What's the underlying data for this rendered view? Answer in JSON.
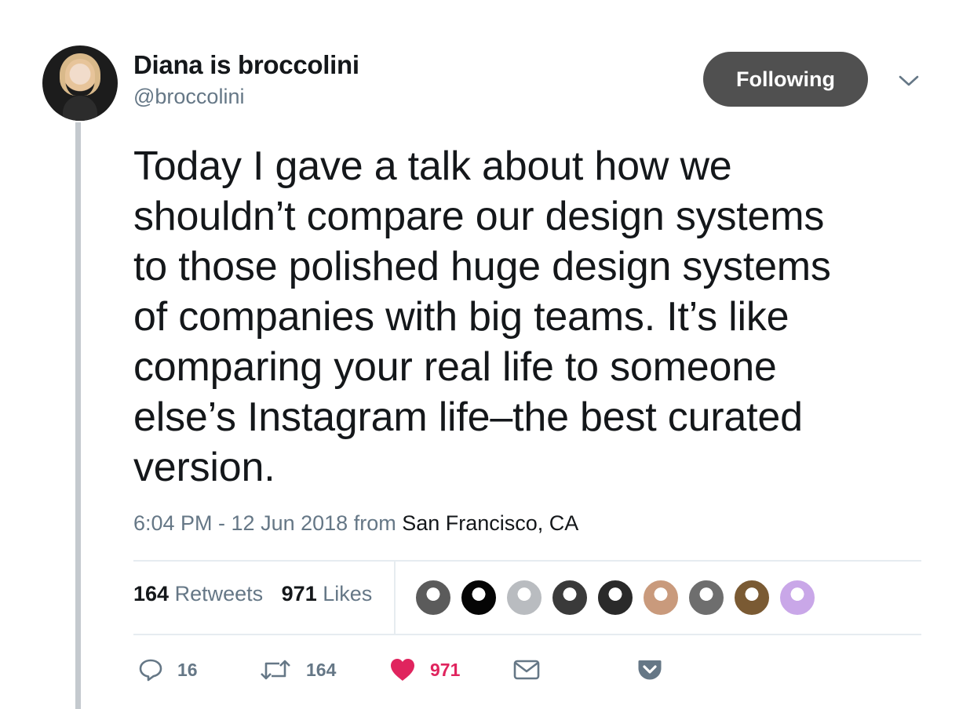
{
  "author": {
    "display_name": "Diana is broccolini",
    "handle": "@broccolini"
  },
  "follow_button": {
    "label": "Following"
  },
  "tweet": {
    "text_lines": [
      "Today I gave a talk about how we",
      "shouldn’t compare our design systems",
      "to those polished huge design systems",
      "of companies with big teams. It’s like",
      "comparing your real life to someone",
      "else’s Instagram life–the best curated",
      "version."
    ],
    "timestamp": "6:04 PM - 12 Jun 2018",
    "from_label": "from",
    "location": "San Francisco, CA"
  },
  "stats": {
    "retweets_count": "164",
    "retweets_label": "Retweets",
    "likes_count": "971",
    "likes_label": "Likes"
  },
  "likers": [
    {
      "icon": "liker-avatar",
      "color": "#5b5b5b"
    },
    {
      "icon": "liker-avatar",
      "color": "#050505"
    },
    {
      "icon": "liker-avatar",
      "color": "#b9bcc0"
    },
    {
      "icon": "liker-avatar",
      "color": "#3a3a3a"
    },
    {
      "icon": "liker-avatar",
      "color": "#2a2a2a"
    },
    {
      "icon": "liker-avatar",
      "color": "#c99a7c"
    },
    {
      "icon": "liker-avatar",
      "color": "#6e6e6e"
    },
    {
      "icon": "liker-avatar",
      "color": "#7a5a33"
    },
    {
      "icon": "liker-avatar",
      "color": "#c9a7e8"
    }
  ],
  "actions": {
    "reply_count": "16",
    "retweet_count": "164",
    "like_count": "971"
  },
  "colors": {
    "like_accent": "#e0245e",
    "secondary_text": "#657786",
    "follow_button_bg": "#505050"
  }
}
